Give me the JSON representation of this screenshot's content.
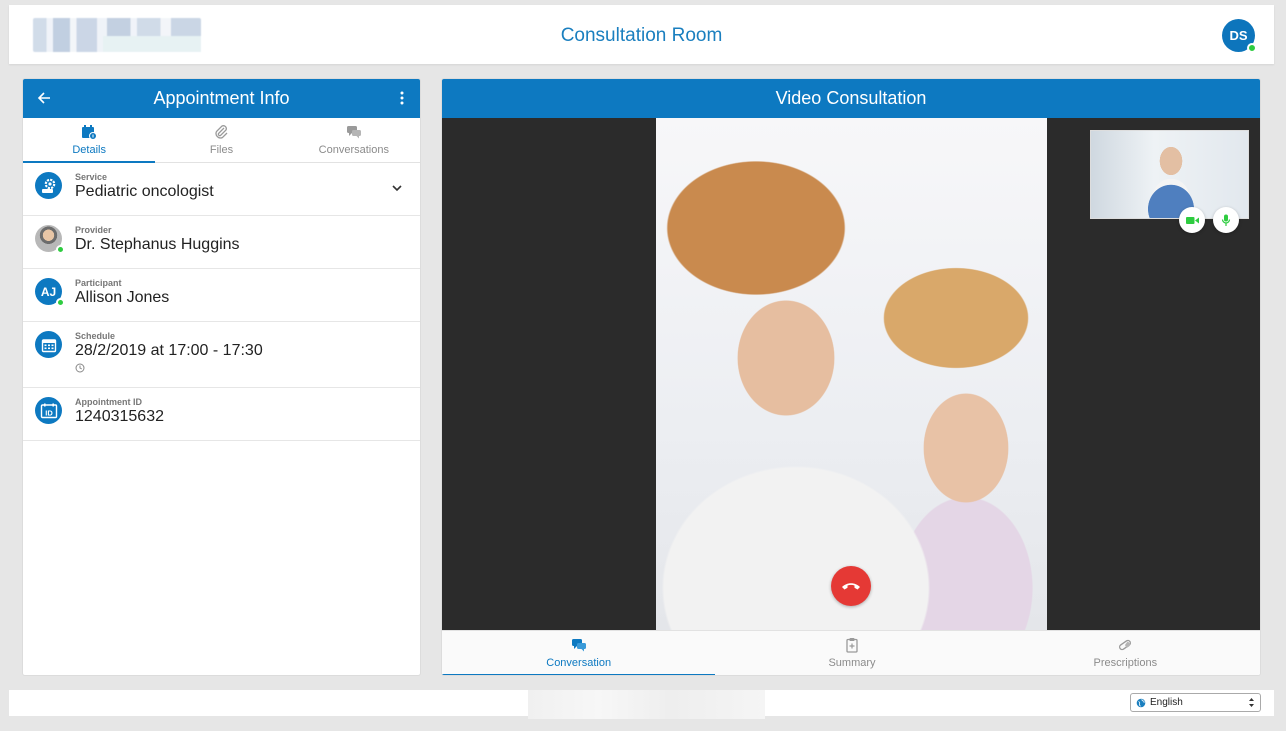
{
  "header": {
    "title": "Consultation Room",
    "user_initials": "DS"
  },
  "appointment_panel": {
    "title": "Appointment Info",
    "tabs": [
      {
        "label": "Details",
        "icon": "calendar-info-icon",
        "active": true
      },
      {
        "label": "Files",
        "icon": "paperclip-icon",
        "active": false
      },
      {
        "label": "Conversations",
        "icon": "chat-bubbles-icon",
        "active": false
      }
    ],
    "service": {
      "label": "Service",
      "value": "Pediatric oncologist"
    },
    "provider": {
      "label": "Provider",
      "value": "Dr. Stephanus Huggins"
    },
    "participant": {
      "label": "Participant",
      "value": "Allison Jones",
      "initials": "AJ"
    },
    "schedule": {
      "label": "Schedule",
      "value": "28/2/2019 at 17:00 - 17:30"
    },
    "appointment_id": {
      "label": "Appointment ID",
      "value": "1240315632"
    }
  },
  "video_panel": {
    "title": "Video Consultation",
    "bottom_tabs": [
      {
        "label": "Conversation",
        "icon": "chat-bubbles-icon",
        "active": true
      },
      {
        "label": "Summary",
        "icon": "clipboard-icon",
        "active": false
      },
      {
        "label": "Prescriptions",
        "icon": "pill-icon",
        "active": false
      }
    ]
  },
  "footer": {
    "language": "English"
  },
  "colors": {
    "brand": "#0d79c1",
    "presence": "#2ecc40",
    "end_call": "#e53935"
  }
}
